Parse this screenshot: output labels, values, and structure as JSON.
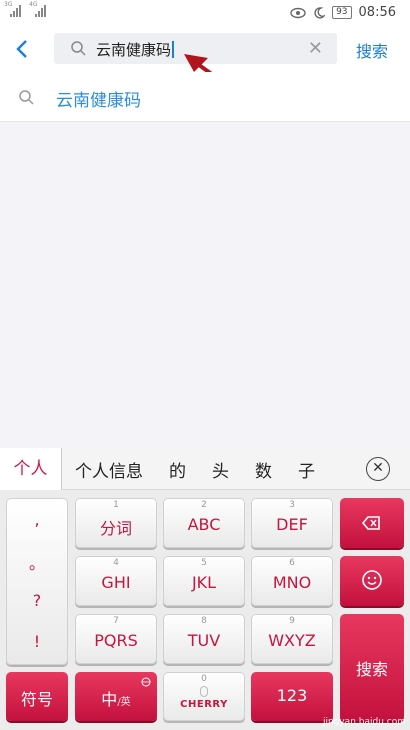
{
  "status": {
    "net1": "3G",
    "net2": "4G",
    "battery": "93",
    "time": "08:56"
  },
  "header": {
    "query": "云南健康码",
    "search_btn": "搜索"
  },
  "suggestion": {
    "text": "云南健康码"
  },
  "keyboard": {
    "candidates_first": "个人",
    "candidates": [
      "个人信息",
      "的",
      "头",
      "数",
      "子"
    ],
    "punct": [
      ",",
      "。",
      "?",
      "!"
    ],
    "keys": [
      {
        "num": "1",
        "label": "分词"
      },
      {
        "num": "2",
        "label": "ABC"
      },
      {
        "num": "3",
        "label": "DEF"
      },
      {
        "num": "4",
        "label": "GHI"
      },
      {
        "num": "5",
        "label": "JKL"
      },
      {
        "num": "6",
        "label": "MNO"
      },
      {
        "num": "7",
        "label": "PQRS"
      },
      {
        "num": "8",
        "label": "TUV"
      },
      {
        "num": "9",
        "label": "WXYZ"
      }
    ],
    "symbols": "符号",
    "lang_zh": "中",
    "lang_en": "/英",
    "space_num": "0",
    "space_brand": "CHERRY",
    "numbers": "123",
    "enter": "搜索"
  },
  "watermark": {
    "text": "jingyan.baidu.com"
  }
}
